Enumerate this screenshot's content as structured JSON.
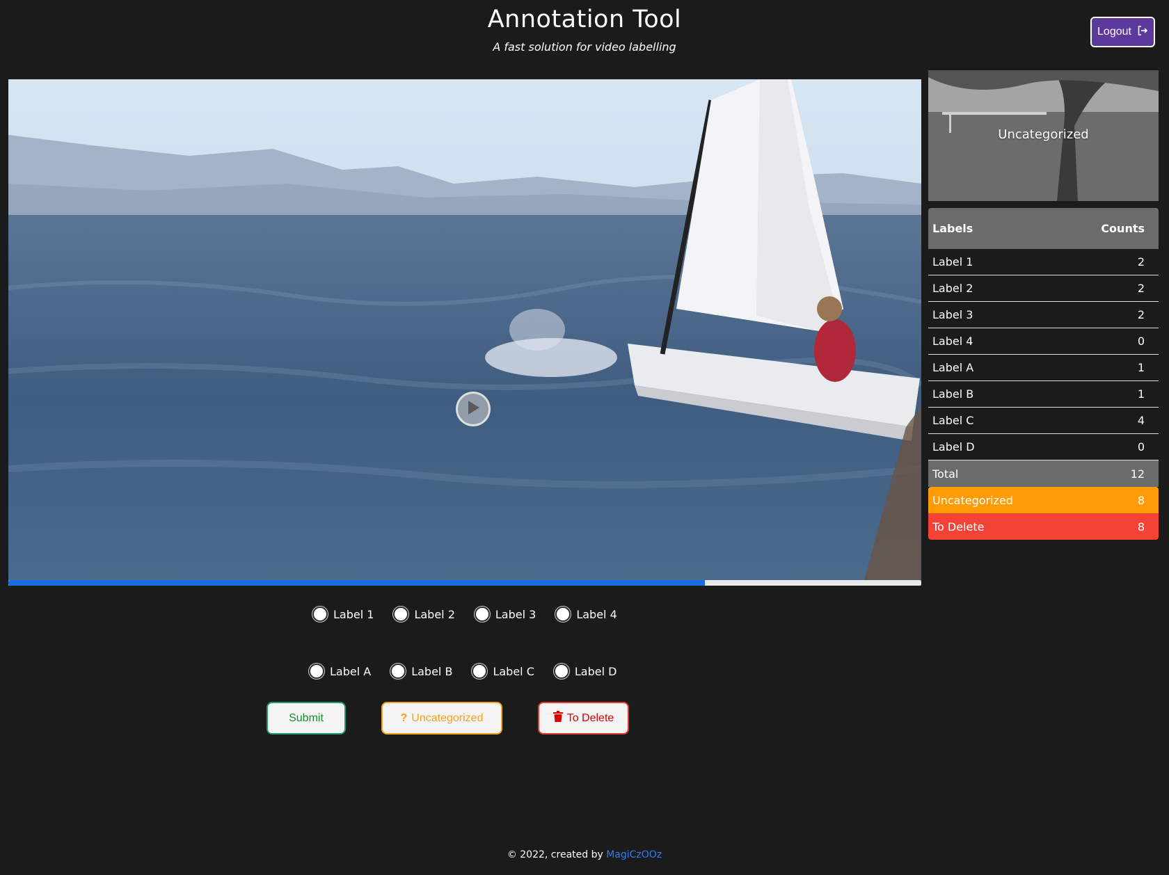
{
  "header": {
    "title": "Annotation Tool",
    "subtitle": "A fast solution for video labelling",
    "logout_label": "Logout"
  },
  "video": {
    "progress_fraction": 0.763
  },
  "thumbnail": {
    "label": "Uncategorized"
  },
  "counts_table": {
    "header_labels": "Labels",
    "header_counts": "Counts",
    "rows": [
      {
        "label": "Label 1",
        "count": "2"
      },
      {
        "label": "Label 2",
        "count": "2"
      },
      {
        "label": "Label 3",
        "count": "2"
      },
      {
        "label": "Label 4",
        "count": "0"
      },
      {
        "label": "Label A",
        "count": "1"
      },
      {
        "label": "Label B",
        "count": "1"
      },
      {
        "label": "Label C",
        "count": "4"
      },
      {
        "label": "Label D",
        "count": "0"
      }
    ],
    "total": {
      "label": "Total",
      "count": "12"
    },
    "uncategorized": {
      "label": "Uncategorized",
      "count": "8"
    },
    "to_delete": {
      "label": "To Delete",
      "count": "8"
    }
  },
  "radio_group_1": [
    "Label 1",
    "Label 2",
    "Label 3",
    "Label 4"
  ],
  "radio_group_2": [
    "Label A",
    "Label B",
    "Label C",
    "Label D"
  ],
  "actions": {
    "submit_label": "Submit",
    "uncategorized_label": "Uncategorized",
    "delete_label": "To Delete"
  },
  "footer": {
    "text": "© 2022, created by",
    "author": "MagiCzOOz"
  },
  "colors": {
    "background": "#1b1b1b",
    "logout": "#5b3a9b",
    "progress": "#1a6fe0",
    "uncategorized": "#ff9c05",
    "to_delete": "#f44336",
    "submit": "#1a8a2f"
  }
}
